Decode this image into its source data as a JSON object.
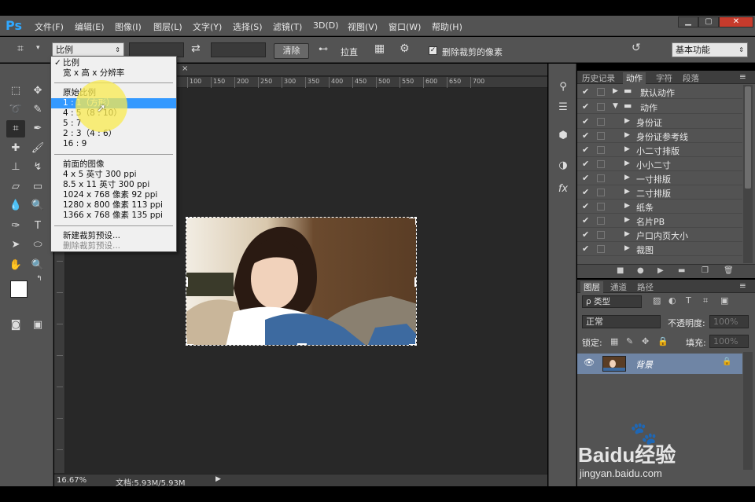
{
  "app": {
    "logo": "Ps"
  },
  "menu": {
    "items": [
      "文件(F)",
      "编辑(E)",
      "图像(I)",
      "图层(L)",
      "文字(Y)",
      "选择(S)",
      "滤镜(T)",
      "3D(D)",
      "视图(V)",
      "窗口(W)",
      "帮助(H)"
    ]
  },
  "window_controls": {
    "minimize": "▁",
    "restore": "▢",
    "close": "✕"
  },
  "options": {
    "ratio_select": "比例",
    "clear_button": "清除",
    "straighten_label": "拉直",
    "delete_pixels_label": "删除裁剪的像素",
    "workspace_select": "基本功能"
  },
  "dropdown": {
    "items": [
      {
        "label": "比例",
        "checked": true
      },
      {
        "label": "宽 x 高 x 分辨率"
      },
      {
        "label": "原始比例"
      },
      {
        "label": "1 : 1（方形）",
        "selected": true
      },
      {
        "label": "4 : 5（8 : 10）"
      },
      {
        "label": "5 : 7"
      },
      {
        "label": "2 : 3（4 : 6）"
      },
      {
        "label": "16 : 9"
      },
      {
        "label": "前面的图像"
      },
      {
        "label": "4 x 5 英寸 300 ppi"
      },
      {
        "label": "8.5 x 11 英寸 300 ppi"
      },
      {
        "label": "1024 x 768 像素 92 ppi"
      },
      {
        "label": "1280 x 800 像素 113 ppi"
      },
      {
        "label": "1366 x 768 像素 135 ppi"
      },
      {
        "label": "新建裁剪预设..."
      },
      {
        "label": "删除裁剪预设...",
        "disabled": true
      }
    ]
  },
  "ruler": {
    "ticks": [
      "100",
      "150",
      "200",
      "250",
      "300",
      "350",
      "400",
      "450",
      "500",
      "550",
      "600",
      "650",
      "700"
    ]
  },
  "status": {
    "zoom": "16.67%",
    "doc": "文档:5.93M/5.93M"
  },
  "actions_panel": {
    "tabs": [
      "历史记录",
      "动作",
      "字符",
      "段落"
    ],
    "active_tab": "动作",
    "rows": [
      {
        "label": "默认动作",
        "folder": true
      },
      {
        "label": "动作",
        "folder": true,
        "expanded": true
      },
      {
        "label": "身份证"
      },
      {
        "label": "身份证参考线"
      },
      {
        "label": "小二寸排版"
      },
      {
        "label": "小小二寸"
      },
      {
        "label": "一寸排版"
      },
      {
        "label": "二寸排版"
      },
      {
        "label": "纸条"
      },
      {
        "label": "名片PB"
      },
      {
        "label": "户口内页大小"
      },
      {
        "label": "裁图"
      }
    ]
  },
  "layers_panel": {
    "tabs": [
      "图层",
      "通道",
      "路径"
    ],
    "filter": "ρ 类型",
    "blend_mode": "正常",
    "opacity_label": "不透明度:",
    "opacity_value": "100%",
    "lock_label": "锁定:",
    "fill_label": "填充:",
    "fill_value": "100%",
    "layer_name": "背景"
  },
  "watermark": {
    "brand": "Baidu经验",
    "url": "jingyan.baidu.com"
  }
}
